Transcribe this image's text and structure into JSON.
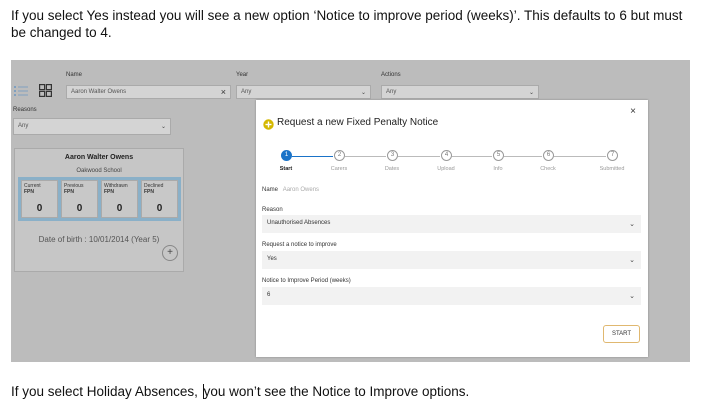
{
  "doc": {
    "para_top": "If you select Yes instead you will see a new option ‘Notice to improve period (weeks)’. This defaults to 6 but must be changed to 4.",
    "para_bottom_1": "If you select Holiday Absences, ",
    "para_bottom_2": "you won’t see the Notice to Improve options."
  },
  "screenshot": {
    "filters": {
      "name_label": "Name",
      "name_value": "Aaron Walter Owens",
      "year_label": "Year",
      "year_value": "Any",
      "actions_label": "Actions",
      "actions_value": "Any",
      "reasons_label": "Reasons",
      "reasons_value": "Any"
    },
    "card": {
      "name": "Aaron Walter Owens",
      "school": "Oakwood School",
      "stats": [
        {
          "label1": "Current",
          "label2": "FPN",
          "value": "0"
        },
        {
          "label1": "Previous",
          "label2": "FPN",
          "value": "0"
        },
        {
          "label1": "Withdrawn",
          "label2": "FPN",
          "value": "0"
        },
        {
          "label1": "Declined",
          "label2": "FPN",
          "value": "0"
        }
      ],
      "dob": "Date of birth : 10/01/2014 (Year 5)",
      "plus": "+"
    },
    "modal": {
      "title": "Request a new Fixed Penalty Notice",
      "close": "×",
      "steps": [
        {
          "num": "1",
          "label": "Start"
        },
        {
          "num": "2",
          "label": "Carers"
        },
        {
          "num": "3",
          "label": "Dates"
        },
        {
          "num": "4",
          "label": "Upload"
        },
        {
          "num": "5",
          "label": "Info"
        },
        {
          "num": "6",
          "label": "Check"
        },
        {
          "num": "7",
          "label": "Submitted"
        }
      ],
      "name_label": "Name",
      "name_value": "Aaron Owens",
      "reason_label": "Reason",
      "reason_value": "Unauthorised Absences",
      "notice_label": "Request a notice to improve",
      "notice_value": "Yes",
      "period_label": "Notice to Improve Period (weeks)",
      "period_value": "6",
      "start_button": "START"
    }
  },
  "colors": {
    "accent": "#1a73c8",
    "title_icon": "#d4b800",
    "overlay": "#bcbcbc"
  }
}
